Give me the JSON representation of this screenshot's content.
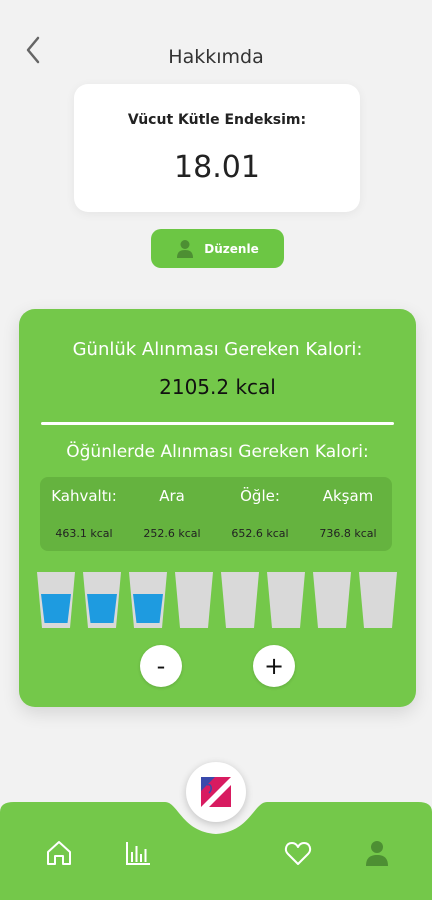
{
  "header": {
    "title": "Hakkımda",
    "back_icon": "chevron-left-icon"
  },
  "bmi": {
    "label": "Vücut Kütle Endeksim:",
    "value": "18.01"
  },
  "edit_button": {
    "label": "Düzenle",
    "icon": "user-icon"
  },
  "calories": {
    "daily_label": "Günlük Alınması Gereken Kalori:",
    "daily_value": "2105.2 kcal",
    "meals_label": "Öğünlerde Alınması Gereken Kalori:",
    "meals": [
      {
        "name": "Kahvaltı:",
        "kcal": "463.1 kcal"
      },
      {
        "name": "Ara",
        "kcal": "252.6 kcal"
      },
      {
        "name": "Öğle:",
        "kcal": "652.6 kcal"
      },
      {
        "name": "Akşam",
        "kcal": "736.8 kcal"
      }
    ]
  },
  "water": {
    "filled": 3,
    "total": 8,
    "minus_label": "-",
    "plus_label": "+"
  },
  "colors": {
    "accent": "#74c84a",
    "water": "#1e9be0",
    "glass": "#d9d9d9"
  },
  "nav": {
    "items": [
      {
        "icon": "home-icon"
      },
      {
        "icon": "bar-chart-icon"
      },
      {
        "icon": "heart-icon"
      },
      {
        "icon": "user-icon"
      }
    ],
    "center_logo": "app-logo"
  }
}
